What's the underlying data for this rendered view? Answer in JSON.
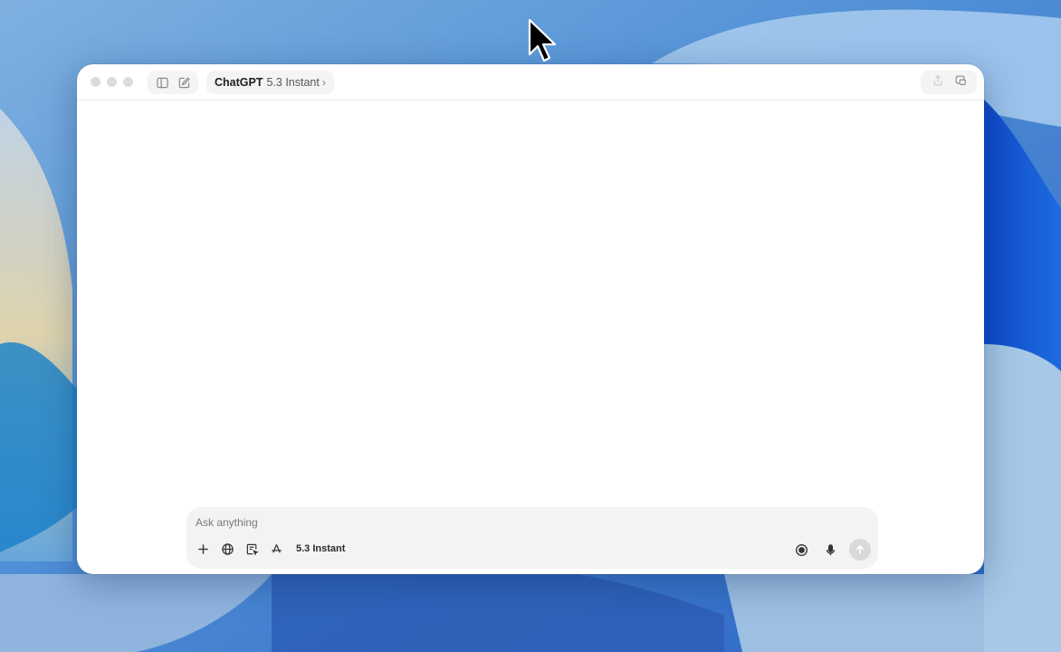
{
  "colors": {
    "window_bg": "#ffffff",
    "pill_bg": "#f4f4f4",
    "composer_bg": "#f3f3f3",
    "traffic_inactive": "#dcdcdc",
    "send_disabled": "#d9d9d9"
  },
  "titlebar": {
    "traffic_lights": [
      "close-icon",
      "minimize-icon",
      "zoom-icon"
    ],
    "left_icons": [
      "sidebar-toggle-icon",
      "new-chat-icon"
    ],
    "model_selector": {
      "brand": "ChatGPT",
      "version": "5.3 Instant",
      "chevron": "›"
    },
    "right_icons": [
      "share-icon",
      "new-window-icon"
    ]
  },
  "composer": {
    "placeholder": "Ask anything",
    "value": "",
    "tools": [
      "plus-icon",
      "globe-icon",
      "canvas-icon",
      "apps-icon"
    ],
    "model_label": "5.3 Instant",
    "right_icons": [
      "voice-mode-icon",
      "microphone-icon",
      "send-arrow-icon"
    ]
  }
}
